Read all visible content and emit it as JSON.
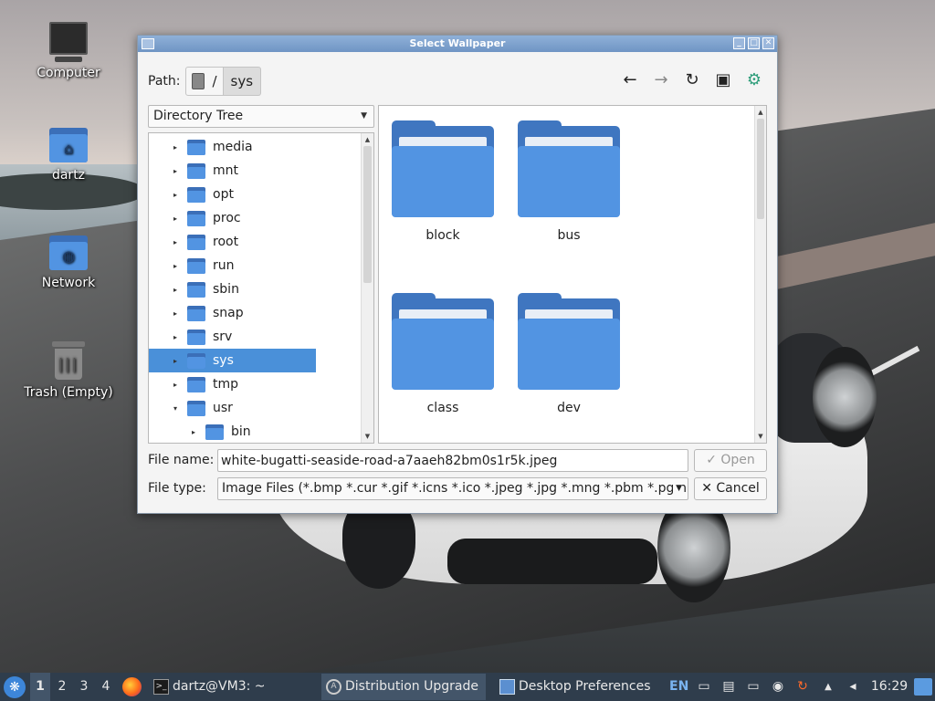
{
  "desktop": {
    "icons": [
      {
        "label": "Computer"
      },
      {
        "label": "dartz"
      },
      {
        "label": "Network"
      },
      {
        "label": "Trash (Empty)"
      }
    ]
  },
  "dialog": {
    "title": "Select Wallpaper",
    "path_label": "Path:",
    "path_segments": [
      "/",
      "sys"
    ],
    "view_combo": "Directory Tree",
    "tree": [
      {
        "label": "media",
        "expander": "▸"
      },
      {
        "label": "mnt",
        "expander": "▸"
      },
      {
        "label": "opt",
        "expander": "▸"
      },
      {
        "label": "proc",
        "expander": "▸"
      },
      {
        "label": "root",
        "expander": "▸"
      },
      {
        "label": "run",
        "expander": "▸"
      },
      {
        "label": "sbin",
        "expander": "▸"
      },
      {
        "label": "snap",
        "expander": "▸"
      },
      {
        "label": "srv",
        "expander": "▸"
      },
      {
        "label": "sys",
        "expander": "▸",
        "selected": true
      },
      {
        "label": "tmp",
        "expander": "▸"
      },
      {
        "label": "usr",
        "expander": "▾"
      },
      {
        "label": "bin",
        "expander": "▸"
      }
    ],
    "files": [
      {
        "name": "block"
      },
      {
        "name": "bus"
      },
      {
        "name": "class"
      },
      {
        "name": "dev"
      }
    ],
    "filename_label": "File name:",
    "filename_value": "white-bugatti-seaside-road-a7aaeh82bm0s1r5k.jpeg",
    "filetype_label": "File type:",
    "filetype_value": "Image Files (*.bmp *.cur *.gif *.icns *.ico *.jpeg *.jpg *.mng *.pbm *.pgm *",
    "open_label": "✓ Open",
    "cancel_label": "✕ Cancel"
  },
  "taskbar": {
    "workspaces": [
      "1",
      "2",
      "3",
      "4"
    ],
    "tasks": [
      {
        "label": "dartz@VM3: ~"
      },
      {
        "label": "Distribution Upgrade"
      },
      {
        "label": "Desktop Preferences"
      }
    ],
    "language": "EN",
    "clock": "16:29"
  },
  "colors": {
    "selection": "#4a90d9",
    "folder": "#5294e2",
    "taskbar": "#2f3d4c"
  }
}
